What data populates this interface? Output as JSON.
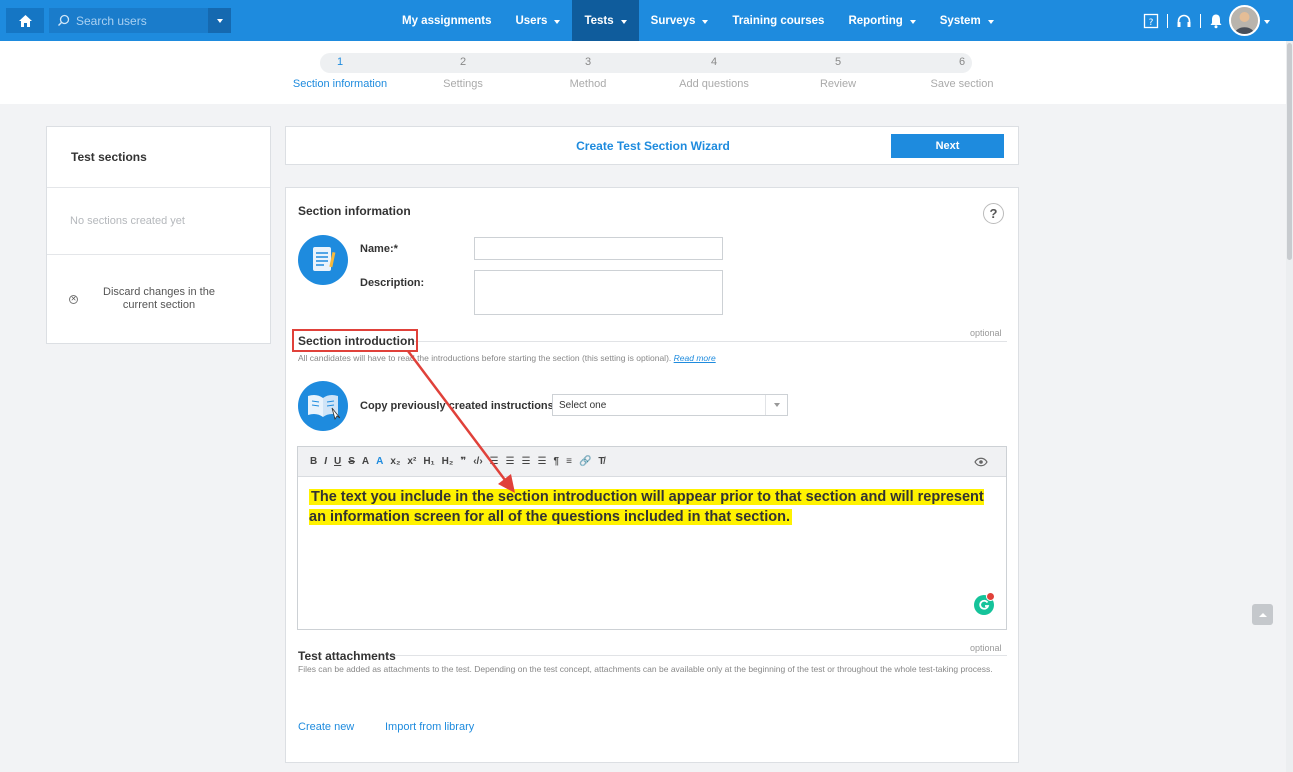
{
  "topbar": {
    "search_placeholder": "Search users",
    "nav": [
      {
        "label": "My assignments",
        "dropdown": false,
        "active": false
      },
      {
        "label": "Users",
        "dropdown": true,
        "active": false
      },
      {
        "label": "Tests",
        "dropdown": true,
        "active": true
      },
      {
        "label": "Surveys",
        "dropdown": true,
        "active": false
      },
      {
        "label": "Training courses",
        "dropdown": false,
        "active": false
      },
      {
        "label": "Reporting",
        "dropdown": true,
        "active": false
      },
      {
        "label": "System",
        "dropdown": true,
        "active": false
      }
    ],
    "icons": [
      "home-icon",
      "search-icon",
      "manual-icon",
      "headset-icon",
      "bell-icon",
      "avatar"
    ]
  },
  "wizard_steps": [
    {
      "num": "1",
      "label": "Section information",
      "active": true
    },
    {
      "num": "2",
      "label": "Settings",
      "active": false
    },
    {
      "num": "3",
      "label": "Method",
      "active": false
    },
    {
      "num": "4",
      "label": "Add questions",
      "active": false
    },
    {
      "num": "5",
      "label": "Review",
      "active": false
    },
    {
      "num": "6",
      "label": "Save section",
      "active": false
    }
  ],
  "left_panel": {
    "title": "Test sections",
    "empty_text": "No sections created yet",
    "discard_text": "Discard changes in the current section"
  },
  "wizard_header": {
    "title": "Create Test Section Wizard",
    "next_label": "Next"
  },
  "section_info": {
    "title": "Section information",
    "help_label": "?",
    "name_label": "Name:*",
    "name_value": "",
    "description_label": "Description:",
    "description_value": ""
  },
  "section_intro": {
    "title": "Section introduction",
    "optional_label": "optional",
    "hint": "All candidates will have to read the introductions before starting the section (this setting is optional).",
    "read_more": "Read more",
    "copy_label": "Copy previously created instructions:",
    "copy_select_value": "Select one",
    "toolbar": [
      "B",
      "I",
      "U",
      "S",
      "A",
      "A",
      "x₂",
      "x²",
      "H₁",
      "H₂",
      "❞",
      "‹/›",
      "☰",
      "☰",
      "☰",
      "☰",
      "¶",
      "≡",
      "🔗",
      "T̸"
    ],
    "editor_text": "The text you include in the section introduction will appear prior to that section and will represent an information screen for all of the questions included in that section."
  },
  "attachments": {
    "title": "Test attachments",
    "optional_label": "optional",
    "hint": "Files can be added as attachments to the test. Depending on the test concept, attachments can be available only at the beginning of the test or throughout the whole test-taking process.",
    "create_new": "Create new",
    "import_library": "Import from library"
  },
  "colors": {
    "brand": "#1e8bde",
    "active_nav": "#0f5c9c",
    "highlight": "#fff200",
    "annotation": "#e0413a"
  }
}
